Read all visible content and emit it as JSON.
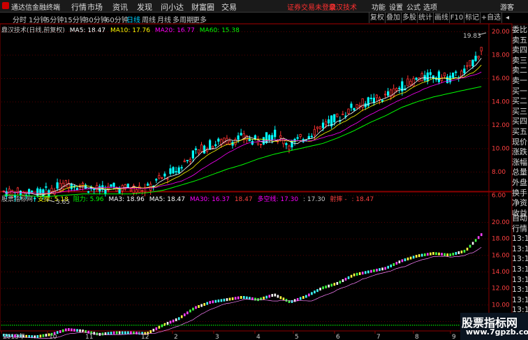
{
  "menu": {
    "app_title": "通达信金融终端",
    "items": [
      "行情",
      "市场",
      "资讯",
      "发现",
      "问小达",
      "财富圈",
      "交易"
    ],
    "login_notice": "证券交易未登录",
    "formula_name": "鼎汉技术",
    "right_items": [
      "功能",
      "设置",
      "公式",
      "选项"
    ],
    "guest": "游客"
  },
  "periods": [
    "分时",
    "1分钟",
    "5分钟",
    "15分钟",
    "30分钟",
    "60分钟",
    "日线",
    "周线",
    "月线",
    "多周期",
    "更多"
  ],
  "active_period": "日线",
  "right_buttons": [
    "复权",
    "叠加",
    "多股",
    "统计",
    "画线",
    "F10",
    "标记",
    "+自选"
  ],
  "main_info": {
    "title": "鼎汉技术(日线,前复权)",
    "ma5": "MA5: 18.47",
    "ma10": "MA10: 17.76",
    "ma20": "MA20: 16.77",
    "ma60": "MA60: 15.38"
  },
  "main_axis": [
    "20.00",
    "18.00",
    "16.00",
    "14.00",
    "12.00",
    "10.00",
    "8.00",
    "6.00"
  ],
  "annotations": {
    "high": "19.83",
    "low": "5.65"
  },
  "sub_info": {
    "title": "股票指标网",
    "support": "支撑: 5.18",
    "resist": "阻力: 5.96",
    "ma3": "MA3: 18.96",
    "ma5": "MA5: 18.47",
    "ma30": "MA30: 16.37",
    "v1": "18.47",
    "duokong": "多空线: 17.30",
    "v2": ": 17.30",
    "shoot": "射摔 -",
    "v3": ": 18.47"
  },
  "sub_axis": [
    "20.00",
    "18.00",
    "16.00",
    "14.00",
    "12.00",
    "10.00",
    "8.00"
  ],
  "date_axis": [
    "2013年",
    "10",
    "11",
    "12",
    "2",
    "3",
    "4",
    "5",
    "6",
    "7",
    "8",
    "9"
  ],
  "quote_labels": [
    "委比",
    "卖五",
    "卖四",
    "卖三",
    "卖二",
    "卖一",
    "买一",
    "买二",
    "买三",
    "买四",
    "买五",
    "现价",
    "涨跌",
    "涨幅",
    "总量",
    "外盘",
    "换手",
    "净资",
    "收益"
  ],
  "quote_labels2": [
    "自动",
    "行情",
    "13:1",
    "13:1",
    "13:1",
    "13:1",
    "13:1",
    "13:1",
    "13:1",
    "13:1",
    "13:1"
  ],
  "watermark": {
    "line1": "股票指标网",
    "line2": "www.7gpzb.com"
  },
  "colors": {
    "up": "#ff3232",
    "down": "#00ffff",
    "ma5": "#ffffff",
    "ma10": "#ffff00",
    "ma20": "#ff00ff",
    "ma60": "#00ff00",
    "grid": "#8b0000"
  },
  "chart_data": {
    "type": "line",
    "title": "鼎汉技术(日线,前复权)",
    "series": [
      {
        "name": "MA5",
        "values": [
          6.3,
          6.2,
          6.1,
          6.4,
          7.0,
          6.8,
          6.4,
          6.6,
          6.6,
          6.5,
          7.5,
          8.3,
          9.6,
          10.3,
          10.6,
          10.9,
          10.6,
          11.2,
          10.3,
          11.0,
          12.0,
          12.6,
          13.6,
          14.0,
          14.4,
          15.3,
          15.9,
          16.2,
          16.0,
          16.5,
          18.47
        ]
      },
      {
        "name": "MA60",
        "values": [
          6.1,
          6.1,
          6.0,
          6.0,
          6.1,
          6.2,
          6.2,
          6.2,
          6.2,
          6.3,
          6.5,
          6.9,
          7.3,
          7.8,
          8.3,
          8.7,
          9.2,
          9.6,
          9.9,
          10.2,
          10.5,
          11.0,
          11.6,
          12.3,
          12.9,
          13.6,
          14.1,
          14.5,
          14.8,
          15.1,
          15.38
        ]
      }
    ],
    "xlabel": "",
    "ylabel": "",
    "ylim": [
      5,
      20.5
    ]
  }
}
